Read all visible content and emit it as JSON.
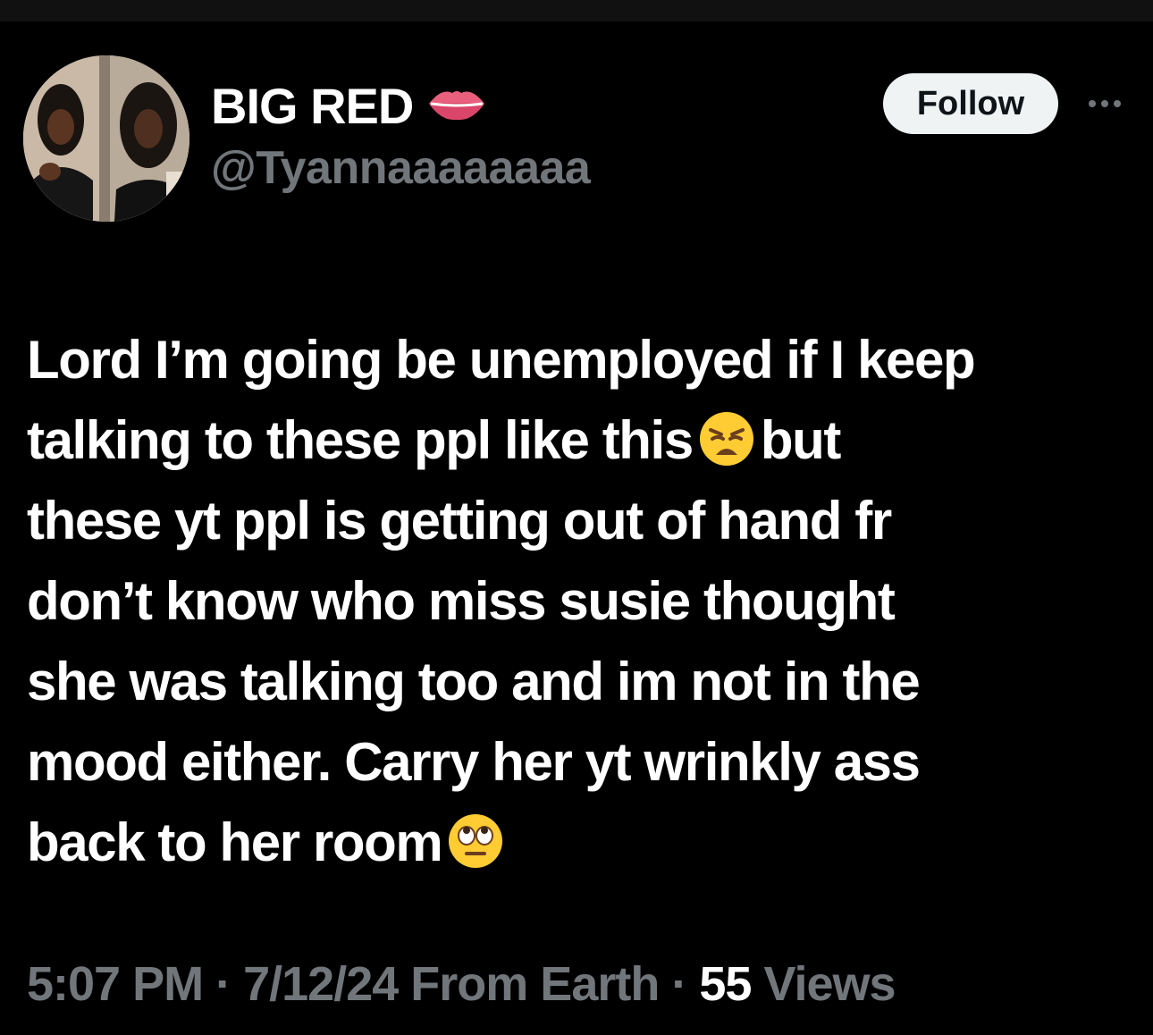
{
  "colors": {
    "background": "#000000",
    "text_primary": "#ffffff",
    "text_secondary": "#71767b",
    "follow_bg": "#eff3f4",
    "follow_text": "#0f1419"
  },
  "author": {
    "display_name": "BIG RED",
    "name_emoji": "lips-icon",
    "handle": "@Tyannaaaaaaaa"
  },
  "actions": {
    "follow_label": "Follow",
    "more_icon": "more-horizontal-icon"
  },
  "tweet": {
    "line1": "Lord I’m going be unemployed if I keep",
    "line2_a": "talking to these ppl like this",
    "line2_emoji": "weary-face-emoji",
    "line2_b": "but",
    "line3": "these yt ppl is getting out of hand fr",
    "line4": "don’t know who miss susie thought",
    "line5": "she was talking too and im not in the",
    "line6": "mood either. Carry her yt wrinkly ass",
    "line7_a": "back to her room",
    "line7_emoji": "eye-roll-emoji"
  },
  "meta": {
    "time": "5:07 PM",
    "separator": "·",
    "date": "7/12/24",
    "source": "From Earth",
    "views_count": "55",
    "views_label": "Views"
  }
}
